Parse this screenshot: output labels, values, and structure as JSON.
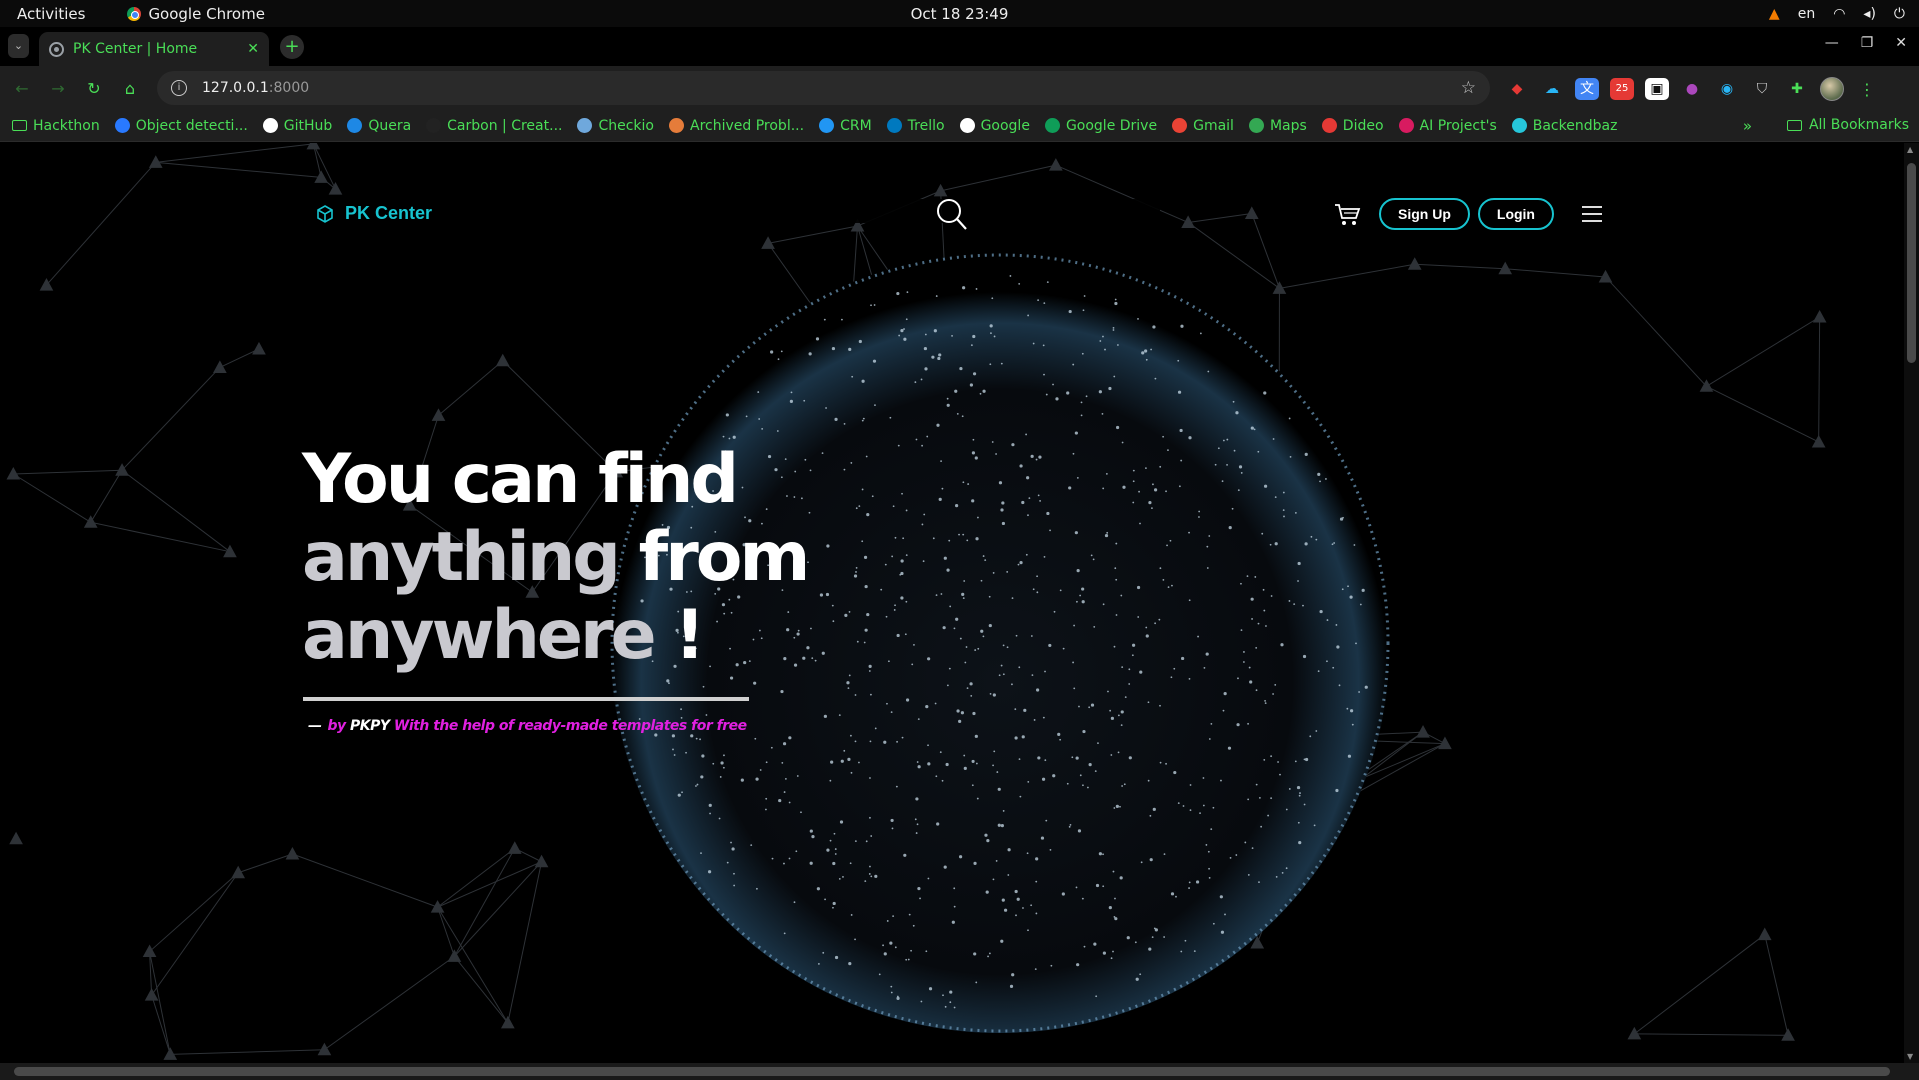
{
  "system": {
    "activities": "Activities",
    "app_name": "Google Chrome",
    "clock": "Oct 18  23:49",
    "lang": "en"
  },
  "browser": {
    "tab_title": "PK Center | Home",
    "url_host": "127.0.0.1",
    "url_port": ":8000",
    "bookmarks": [
      {
        "label": "Hackthon",
        "icon": "folder-icon",
        "color": "#4ade57"
      },
      {
        "label": "Object detecti...",
        "icon": "p-icon",
        "color": "#2979ff"
      },
      {
        "label": "GitHub",
        "icon": "github-icon",
        "color": "#ffffff"
      },
      {
        "label": "Quera",
        "icon": "quera-icon",
        "color": "#1e88e5"
      },
      {
        "label": "Carbon | Creat...",
        "icon": "carbon-icon",
        "color": "#222222"
      },
      {
        "label": "Checkio",
        "icon": "checkio-icon",
        "color": "#6fa8dc"
      },
      {
        "label": "Archived Probl...",
        "icon": "pe-icon",
        "color": "#e57c3a"
      },
      {
        "label": "CRM",
        "icon": "crm-icon",
        "color": "#2196f3"
      },
      {
        "label": "Trello",
        "icon": "trello-icon",
        "color": "#0079bf"
      },
      {
        "label": "Google",
        "icon": "google-icon",
        "color": "#ffffff"
      },
      {
        "label": "Google Drive",
        "icon": "drive-icon",
        "color": "#0f9d58"
      },
      {
        "label": "Gmail",
        "icon": "gmail-icon",
        "color": "#ea4335"
      },
      {
        "label": "Maps",
        "icon": "maps-icon",
        "color": "#34a853"
      },
      {
        "label": "Dideo",
        "icon": "dideo-icon",
        "color": "#e53935"
      },
      {
        "label": "AI Project's",
        "icon": "ai-icon",
        "color": "#d81b60"
      },
      {
        "label": "Backendbaz",
        "icon": "backendbaz-icon",
        "color": "#26c6da"
      }
    ],
    "bookmarks_more": "»",
    "all_bookmarks": "All Bookmarks"
  },
  "site": {
    "logo_text": "PK Center",
    "signup_label": "Sign Up",
    "login_label": "Login",
    "hero": {
      "line1": "You can find",
      "line2_gray": "anything",
      "line2_white": " from",
      "line3_gray": "anywhere",
      "line3_white": " !"
    },
    "byline": {
      "dash": "—",
      "by": "by ",
      "name": "PKPY",
      "rest": " With the help of ready-made templates for free"
    },
    "accent_color": "#17c3cf",
    "byline_color": "#e020e0"
  }
}
